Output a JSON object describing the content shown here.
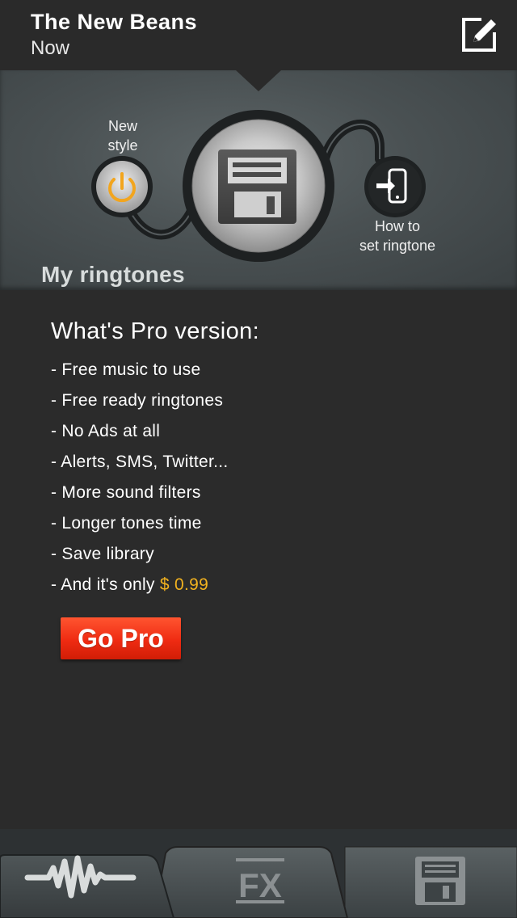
{
  "header": {
    "title": "The New Beans",
    "subtitle": "Now",
    "edit_icon": "compose-icon"
  },
  "hero": {
    "new_style_label": "New\nstyle",
    "how_to_label": "How to\nset ringtone",
    "section_title": "My ringtones",
    "icons": [
      "power-icon",
      "floppy-disk-icon",
      "phone-enter-icon"
    ],
    "accent_color": "#f2a51e"
  },
  "pro": {
    "title": "What's Pro version:",
    "features": [
      "- Free music to use",
      "- Free ready ringtones",
      "- No Ads at all",
      "- Alerts, SMS, Twitter...",
      "- More sound filters",
      "- Longer tones time",
      "- Save library"
    ],
    "price_prefix": "- And it's only ",
    "price": "$ 0.99",
    "price_color": "#f2b21f",
    "button_label": "Go Pro",
    "button_color": "#ef2b12"
  },
  "tabs": [
    {
      "icon": "waveform-icon",
      "label": ""
    },
    {
      "icon": "fx-icon",
      "label": "FX"
    },
    {
      "icon": "floppy-disk-icon",
      "label": ""
    }
  ]
}
